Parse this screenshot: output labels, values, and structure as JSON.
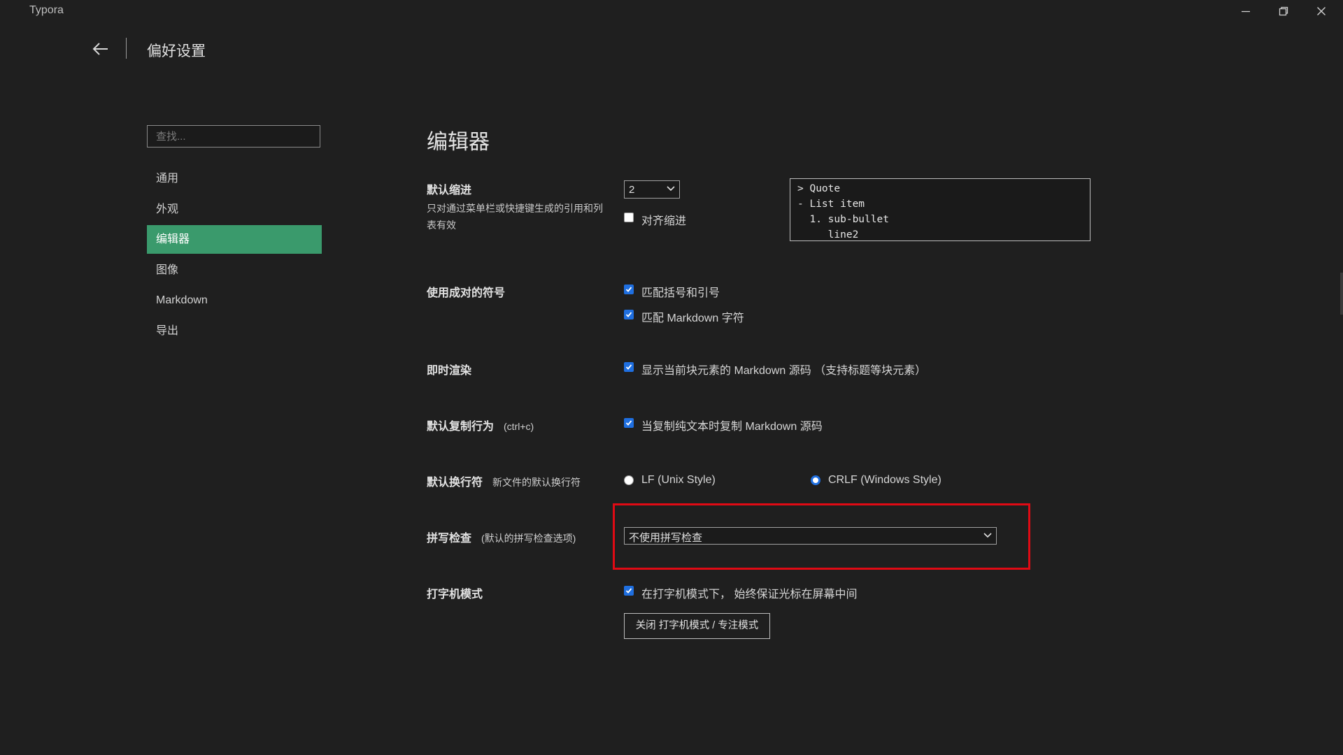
{
  "window": {
    "title": "Typora"
  },
  "header": {
    "title": "偏好设置"
  },
  "sidebar": {
    "search_placeholder": "查找...",
    "items": [
      {
        "label": "通用",
        "active": false
      },
      {
        "label": "外观",
        "active": false
      },
      {
        "label": "编辑器",
        "active": true
      },
      {
        "label": "图像",
        "active": false
      },
      {
        "label": "Markdown",
        "active": false
      },
      {
        "label": "导出",
        "active": false
      }
    ]
  },
  "editor": {
    "title": "编辑器",
    "indent": {
      "label": "默认缩进",
      "description": "只对通过菜单栏或快捷键生成的引用和列表有效",
      "value": "2",
      "align_label": "对齐缩进",
      "align_checked": false,
      "preview_lines": [
        "> Quote",
        "- List item",
        "  1. sub-bullet",
        "     line2"
      ]
    },
    "pairs": {
      "label": "使用成对的符号",
      "options": [
        {
          "label": "匹配括号和引号",
          "checked": true
        },
        {
          "label": "匹配 Markdown 字符",
          "checked": true
        }
      ]
    },
    "live_render": {
      "label": "即时渲染",
      "option": {
        "label": "显示当前块元素的 Markdown 源码 （支持标题等块元素）",
        "checked": true
      }
    },
    "copy": {
      "label": "默认复制行为",
      "sub": "(ctrl+c)",
      "option": {
        "label": "当复制纯文本时复制 Markdown 源码",
        "checked": true
      }
    },
    "line_ending": {
      "label": "默认换行符",
      "sub": "新文件的默认换行符",
      "options": [
        {
          "label": "LF (Unix Style)",
          "selected": false
        },
        {
          "label": "CRLF (Windows Style)",
          "selected": true
        }
      ]
    },
    "spellcheck": {
      "label": "拼写检查",
      "sub": "(默认的拼写检查选项)",
      "value": "不使用拼写检查"
    },
    "typewriter": {
      "label": "打字机模式",
      "option": {
        "label": "在打字机模式下， 始终保证光标在屏幕中间",
        "checked": true
      },
      "button": "关闭 打字机模式 / 专注模式"
    }
  },
  "colors": {
    "background": "#1f1f1f",
    "accent": "#3a9a6c",
    "checkbox": "#1f6fe0",
    "highlight": "#e00a14"
  }
}
